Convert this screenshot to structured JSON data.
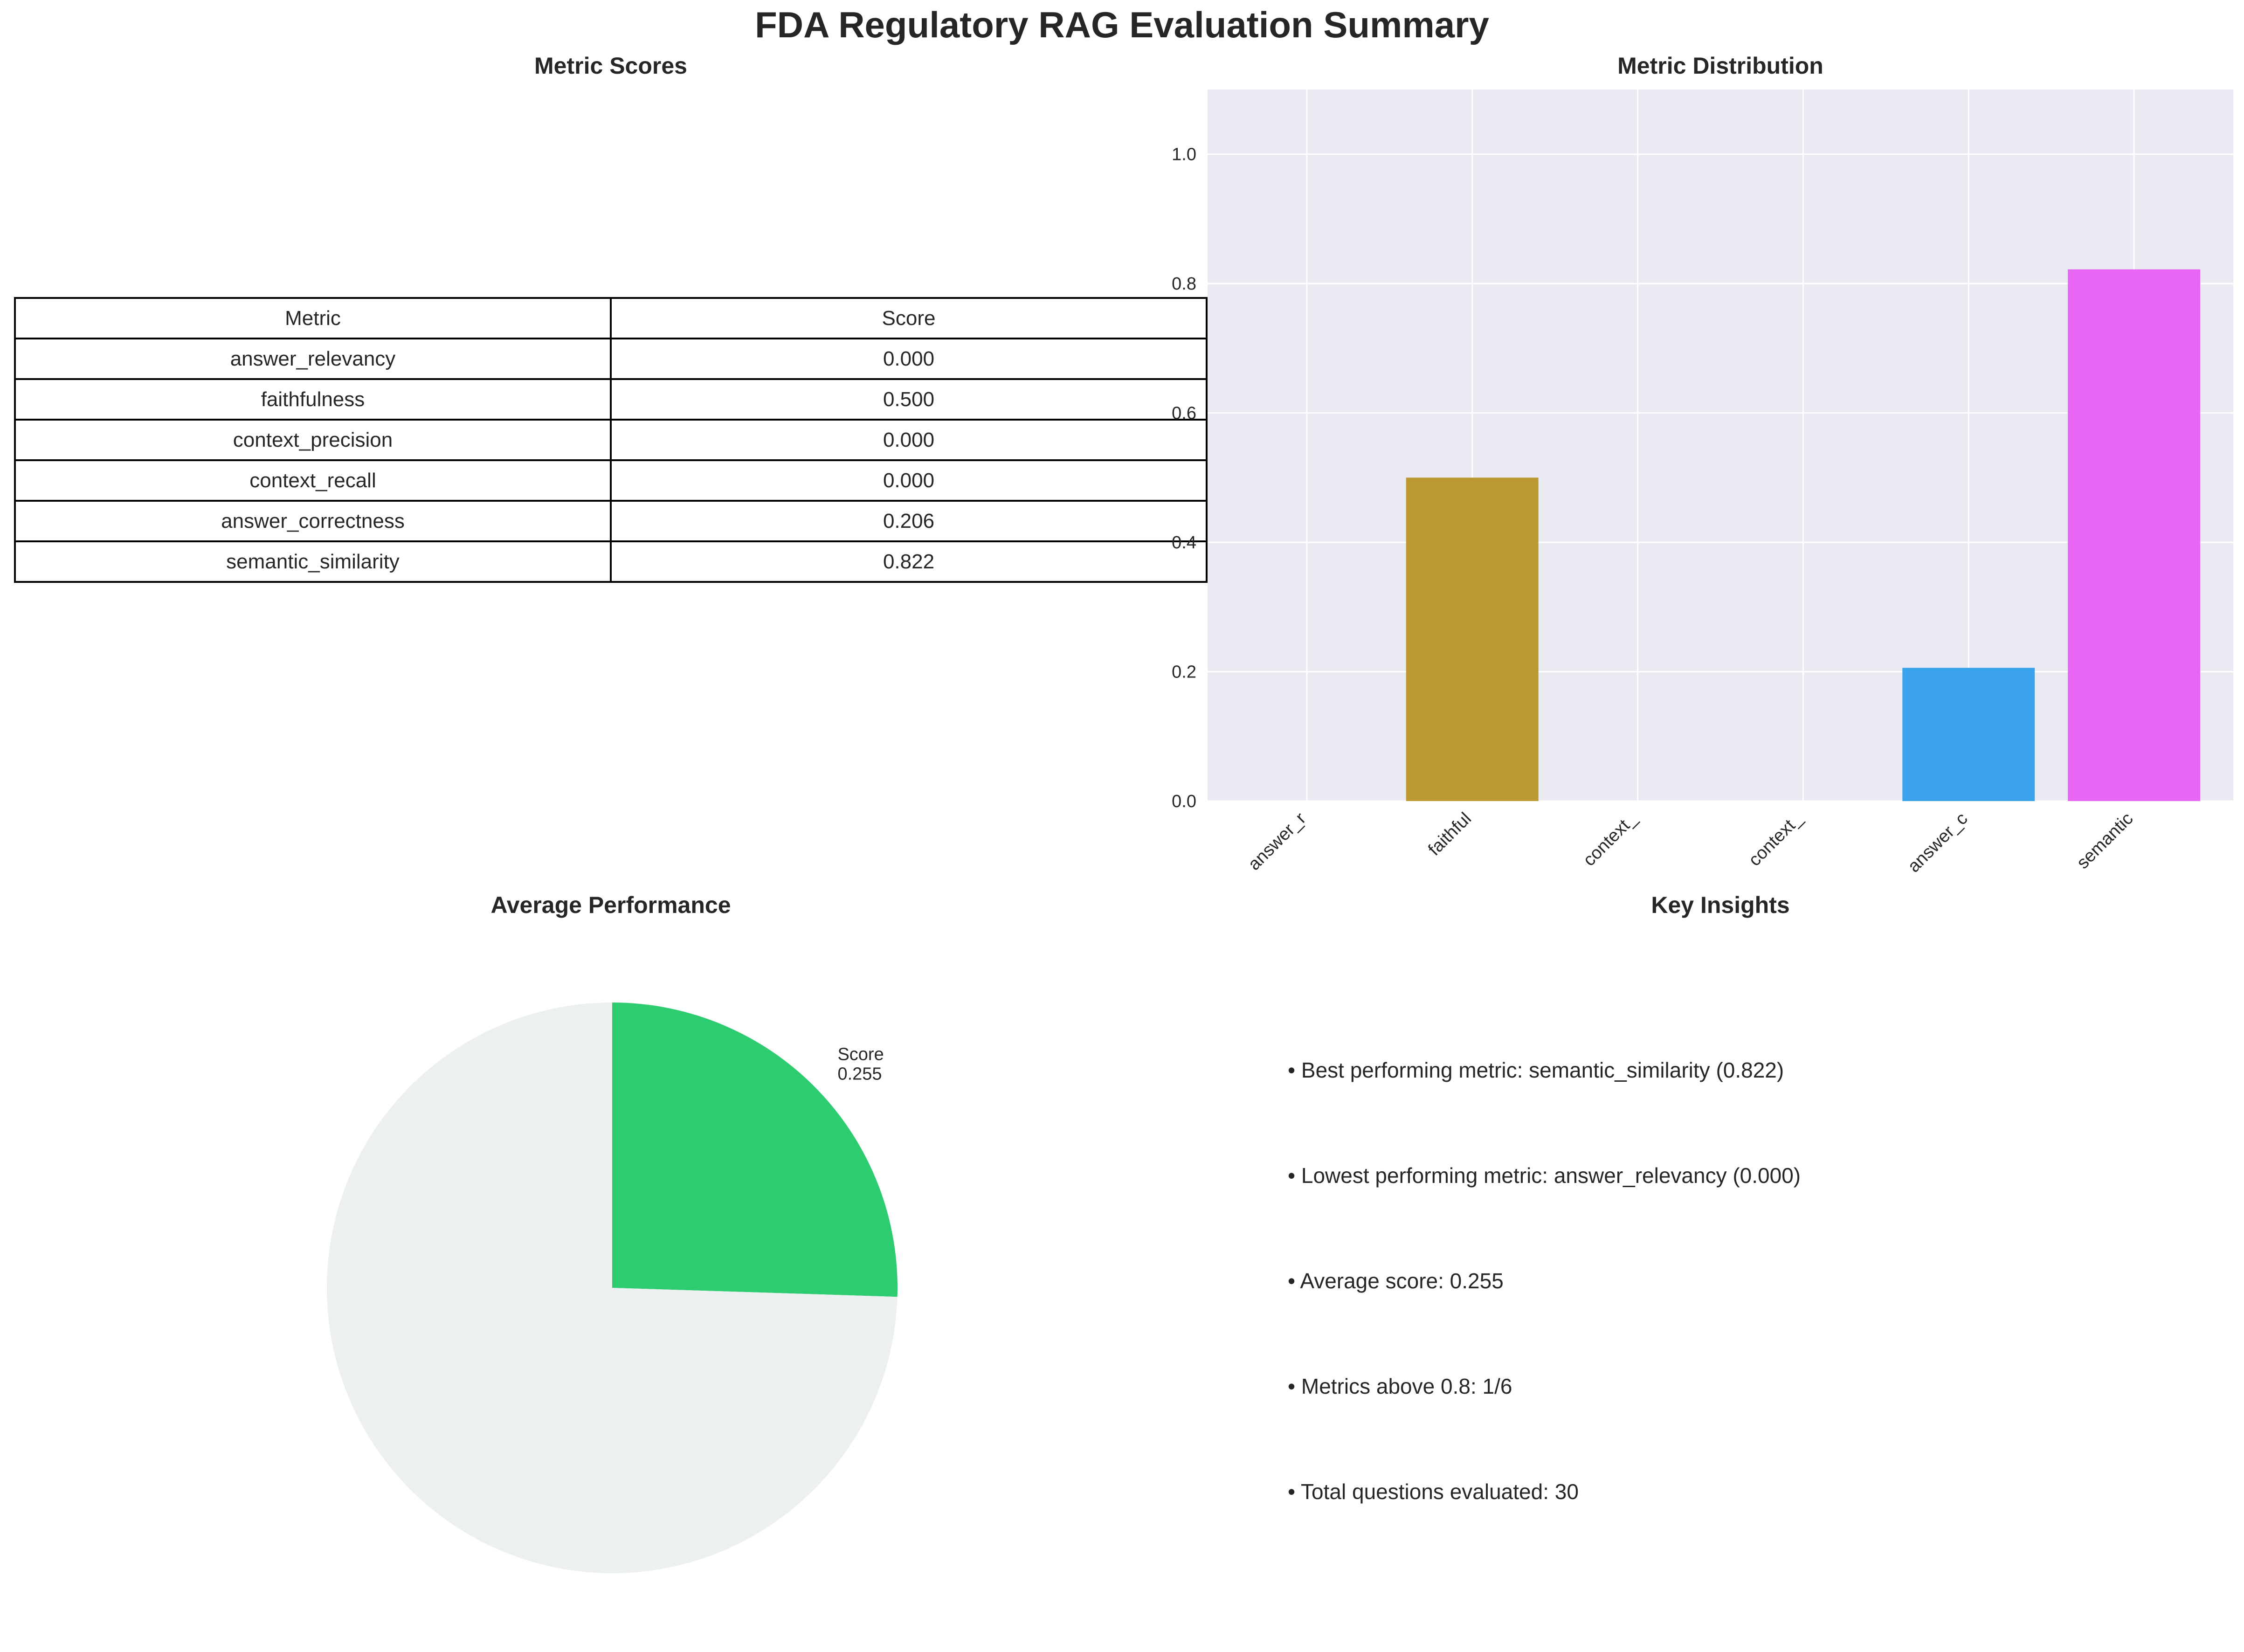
{
  "suptitle": "FDA Regulatory RAG Evaluation Summary",
  "panels": {
    "table_title": "Metric Scores",
    "bar_title": "Metric Distribution",
    "pie_title": "Average Performance",
    "insights_title": "Key Insights"
  },
  "table": {
    "headers": [
      "Metric",
      "Score"
    ],
    "rows": [
      [
        "answer_relevancy",
        "0.000"
      ],
      [
        "faithfulness",
        "0.500"
      ],
      [
        "context_precision",
        "0.000"
      ],
      [
        "context_recall",
        "0.000"
      ],
      [
        "answer_correctness",
        "0.206"
      ],
      [
        "semantic_similarity",
        "0.822"
      ]
    ]
  },
  "insights": [
    "• Best performing metric: semantic_similarity (0.822)",
    "• Lowest performing metric: answer_relevancy (0.000)",
    "• Average score: 0.255",
    "• Metrics above 0.8: 1/6",
    "• Total questions evaluated: 30"
  ],
  "chart_data": [
    {
      "type": "bar",
      "title": "Metric Distribution",
      "categories": [
        "answer_r",
        "faithful",
        "context_",
        "context_",
        "answer_c",
        "semantic"
      ],
      "values": [
        0.0,
        0.5,
        0.0,
        0.0,
        0.206,
        0.822
      ],
      "colors": [
        "#f77189",
        "#bb9832",
        "#50b131",
        "#36ada4",
        "#3ba3ec",
        "#e866f4"
      ],
      "ylim": [
        0,
        1.1
      ],
      "yticks": [
        "0.0",
        "0.2",
        "0.4",
        "0.6",
        "0.8",
        "1.0"
      ],
      "grid": true,
      "background": "#eaeaf2"
    },
    {
      "type": "pie",
      "title": "Average Performance",
      "slices": [
        {
          "label": "Score\n0.255",
          "value": 0.255,
          "color": "#2ecc71"
        },
        {
          "label": "",
          "value": 0.745,
          "color": "#ecf0f1"
        }
      ]
    }
  ]
}
